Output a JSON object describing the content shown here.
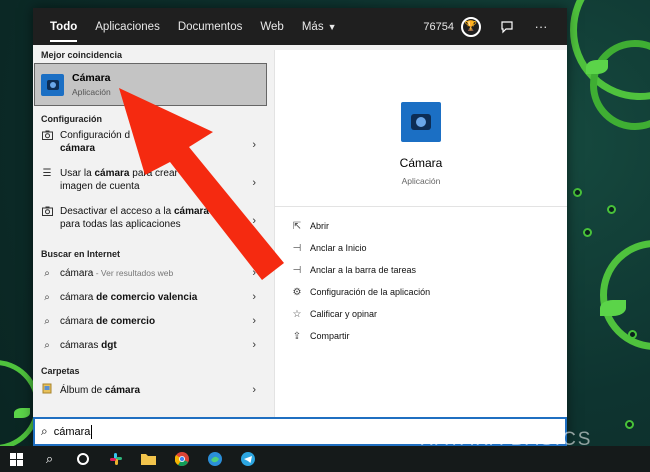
{
  "tabs": [
    "Todo",
    "Aplicaciones",
    "Documentos",
    "Web",
    "Más"
  ],
  "points": "76754",
  "best_match": {
    "section": "Mejor coincidencia",
    "title": "Cámara",
    "subtitle": "Aplicación"
  },
  "settings": {
    "section": "Configuración",
    "items": [
      {
        "pre": "Configuración de la ",
        "bold": "cámara",
        "line2_bold": "",
        "line2": "",
        "visible": "Configuración d",
        "tail": "de",
        "line2_text": "cámara"
      },
      {
        "pre": "Usar la ",
        "bold": "cámara",
        "mid": " para crear u",
        "line2": "imagen de cuenta"
      },
      {
        "pre": "Desactivar el acceso a la ",
        "bold": "cámara",
        "line2": "para todas las aplicaciones"
      }
    ]
  },
  "web": {
    "section": "Buscar en Internet",
    "items": [
      {
        "bold1": "",
        "text": "cámara",
        "extra": " - Ver resultados web"
      },
      {
        "text": "cámara",
        "bold": " de comercio valencia"
      },
      {
        "text": "cámara",
        "bold": " de comercio"
      },
      {
        "text": "cámaras",
        "bold": " dgt"
      }
    ]
  },
  "folders": {
    "section": "Carpetas",
    "items": [
      {
        "pre": "Álbum de ",
        "bold": "cámara"
      }
    ]
  },
  "search": {
    "query": "cámara"
  },
  "detail": {
    "title": "Cámara",
    "subtitle": "Aplicación",
    "actions": [
      {
        "icon": "open-icon",
        "label": "Abrir"
      },
      {
        "icon": "pin-icon",
        "label": "Anclar a Inicio"
      },
      {
        "icon": "pin-icon",
        "label": "Anclar a la barra de tareas"
      },
      {
        "icon": "gear-icon",
        "label": "Configuración de la aplicación"
      },
      {
        "icon": "star-icon",
        "label": "Calificar y opinar"
      },
      {
        "icon": "share-icon",
        "label": "Compartir"
      }
    ]
  },
  "watermark": "XATAKA BASICS",
  "colors": {
    "accent": "#1f6fc1",
    "arrow": "#f52a10",
    "taskbar": "#151a1a"
  }
}
